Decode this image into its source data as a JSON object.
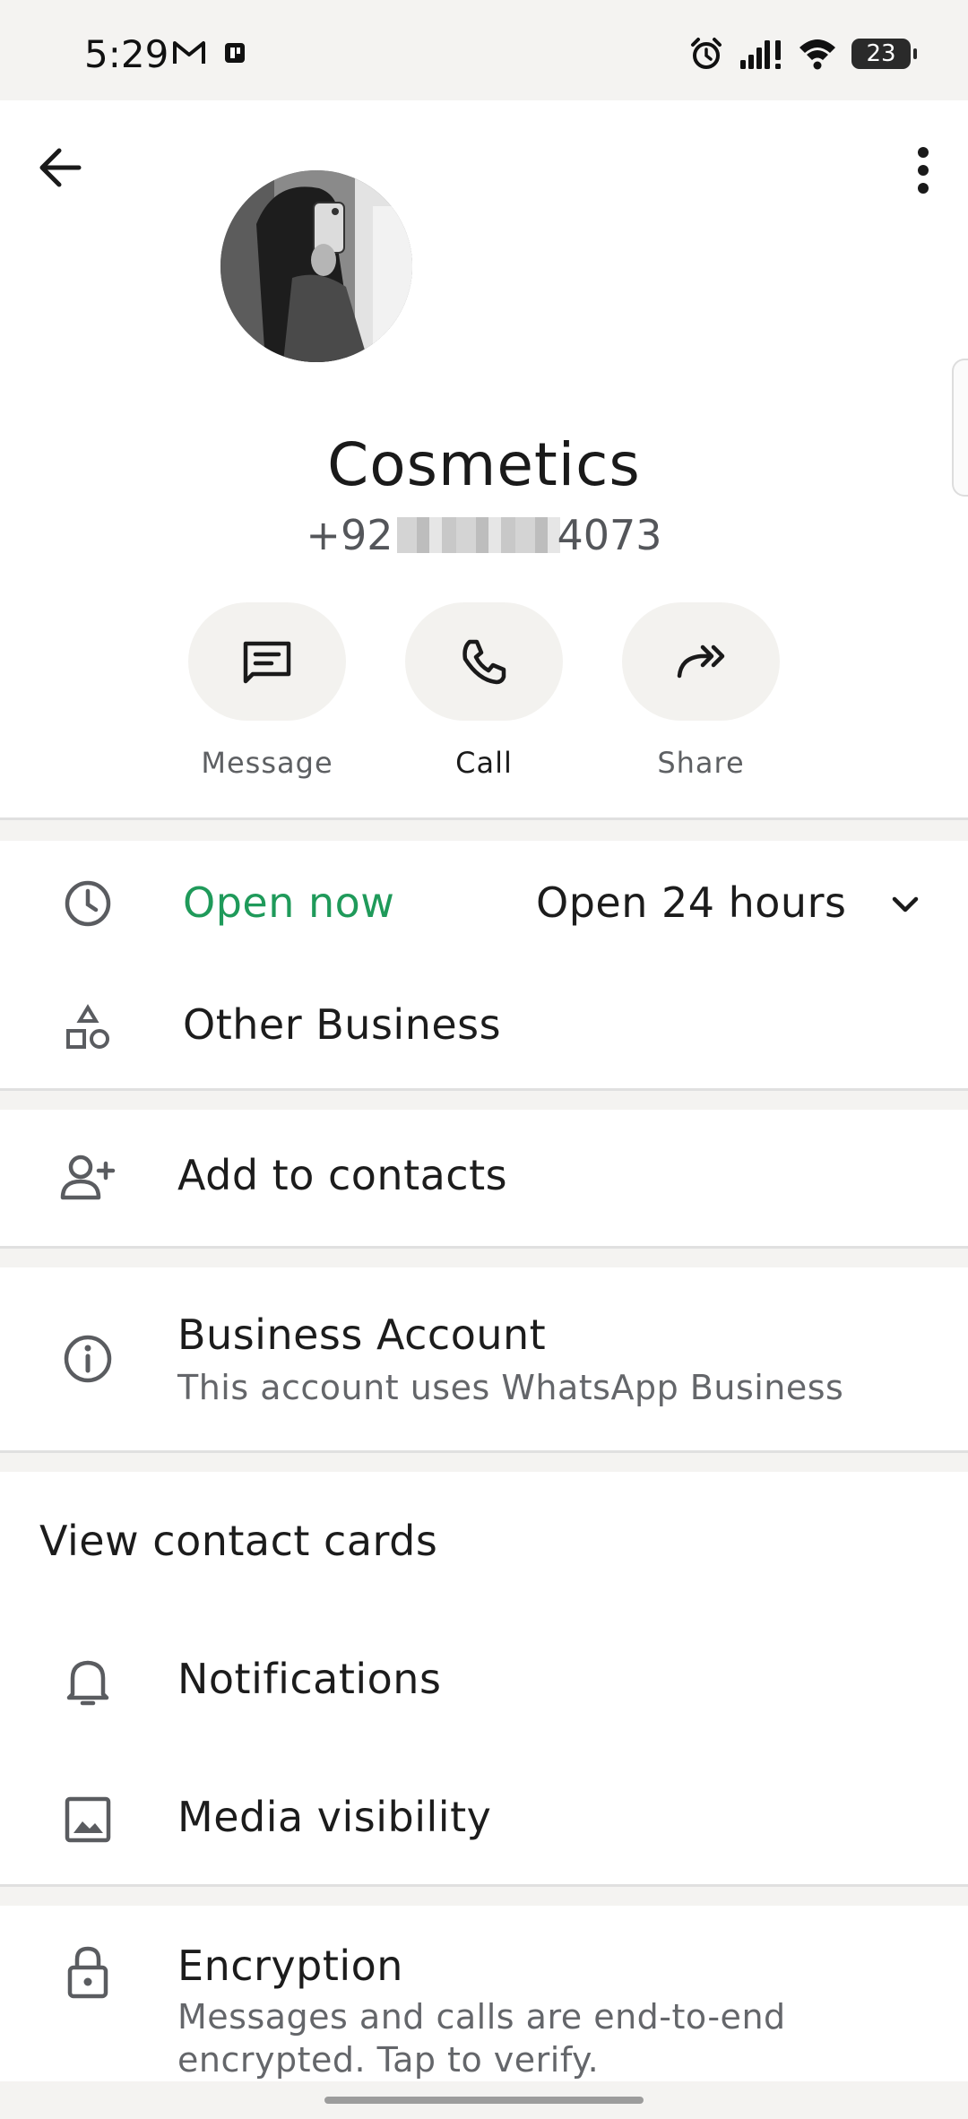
{
  "status_bar": {
    "time": "5:29",
    "left_icons": [
      "gmail-icon",
      "notification-icon"
    ],
    "right_icons": [
      "alarm-icon",
      "signal-icon",
      "wifi-icon",
      "battery-icon"
    ],
    "battery_level": "23"
  },
  "header": {
    "back_icon": "arrow-left-icon",
    "more_icon": "more-vertical-icon",
    "contact_name": "Cosmetics",
    "phone_prefix": "+92",
    "phone_suffix": "4073"
  },
  "actions": [
    {
      "label": "Message",
      "icon": "message-icon"
    },
    {
      "label": "Call",
      "icon": "phone-icon"
    },
    {
      "label": "Share",
      "icon": "share-icon"
    }
  ],
  "business_info": {
    "open_status": "Open now",
    "hours": "Open 24 hours",
    "category": "Other Business"
  },
  "add_contact": {
    "label": "Add to contacts"
  },
  "business_account": {
    "title": "Business Account",
    "subtitle": "This account uses WhatsApp Business"
  },
  "settings": {
    "view_contact_cards": "View contact cards",
    "notifications": "Notifications",
    "media_visibility": "Media visibility"
  },
  "encryption": {
    "title": "Encryption",
    "subtitle_line1": "Messages and calls are end-to-end",
    "subtitle_line2": "encrypted. Tap to verify."
  },
  "colors": {
    "accent_green": "#1f9a5a",
    "background": "#f4f3f1",
    "card": "#ffffff"
  }
}
